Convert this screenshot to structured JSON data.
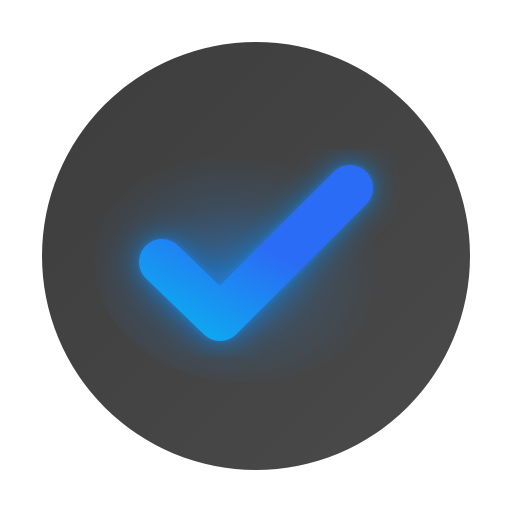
{
  "icon": {
    "name": "checkmark-icon",
    "colors": {
      "background": "#ffffff",
      "circle_dark": "#3d3d3d",
      "circle_light": "#4a4a4a",
      "check_start": "#0fa5f0",
      "check_end": "#2a6cf5",
      "glow": "#1a8cff"
    }
  }
}
